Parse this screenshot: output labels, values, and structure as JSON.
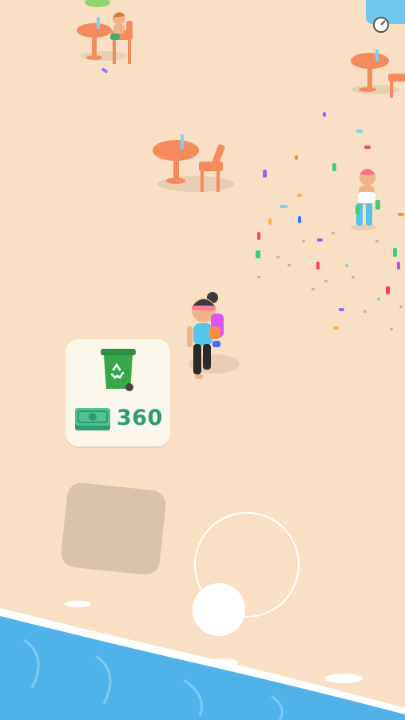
{
  "hud": {
    "upgrade": {
      "item_icon": "recycling-bin-icon",
      "currency_icon": "cash-stack-icon",
      "cost": "360"
    }
  },
  "colors": {
    "sand": "#f9dfc4",
    "water": "#4fb3ea",
    "table": "#f58a5c",
    "cost_text": "#2e9b74",
    "bin": "#37a74a"
  }
}
